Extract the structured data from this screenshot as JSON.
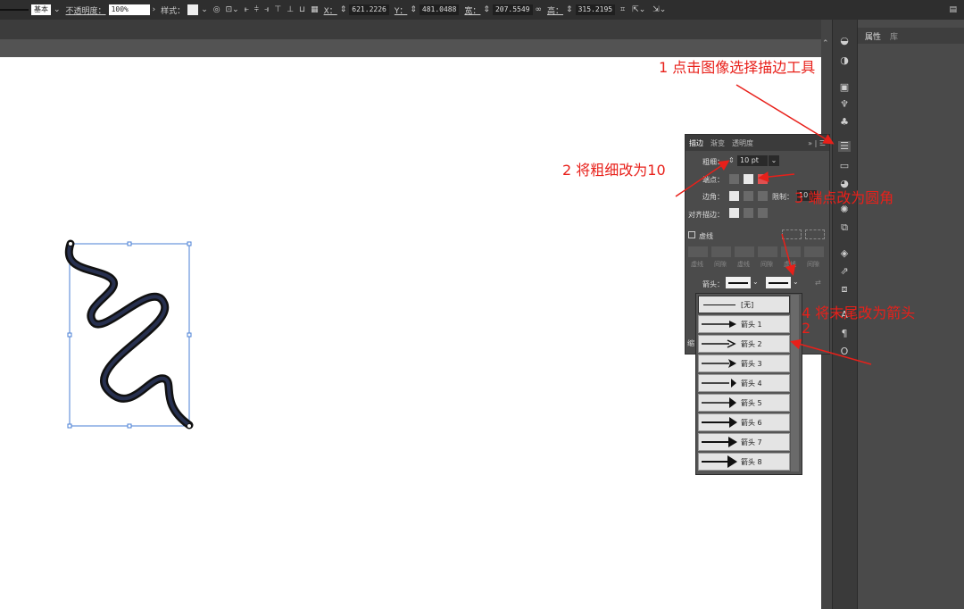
{
  "control_bar": {
    "stroke_style_label": "基本",
    "opacity_label": "不透明度：",
    "opacity_value": "100%",
    "style_label": "样式：",
    "x_label": "X：",
    "x_value": "621.2226",
    "y_label": "Y：",
    "y_value": "481.0488",
    "width_label": "宽：",
    "width_value": "207.5549",
    "height_label": "高：",
    "height_value": "315.2195"
  },
  "properties_panel": {
    "tabs": [
      "属性",
      "库"
    ]
  },
  "stroke_panel": {
    "tabs": [
      "描边",
      "渐变",
      "透明度"
    ],
    "weight_label": "粗细：",
    "weight_value": "10 pt",
    "cap_label": "端点：",
    "corner_label": "边角：",
    "limit_label": "限制：",
    "limit_value": "10",
    "align_label": "对齐描边：",
    "dashed_label": "虚线",
    "dash_cells": [
      "虚线",
      "间隙",
      "虚线",
      "间隙",
      "虚线",
      "间隙"
    ],
    "arrowheads_label": "箭头：",
    "scale_label": "缩"
  },
  "arrow_dropdown": {
    "items": [
      "[无]",
      "箭头 1",
      "箭头 2",
      "箭头 3",
      "箭头 4",
      "箭头 5",
      "箭头 6",
      "箭头 7",
      "箭头 8"
    ]
  },
  "annotations": {
    "step1": "1 点击图像选择描边工具",
    "step2": "2 将粗细改为10",
    "step3": "3 端点改为圆角",
    "step4": "4 将末尾改为箭头",
    "step4b": "2"
  },
  "colors": {
    "annotation": "#e8201a",
    "selection": "#4a7fd6",
    "curve_fill": "#1c2340"
  }
}
